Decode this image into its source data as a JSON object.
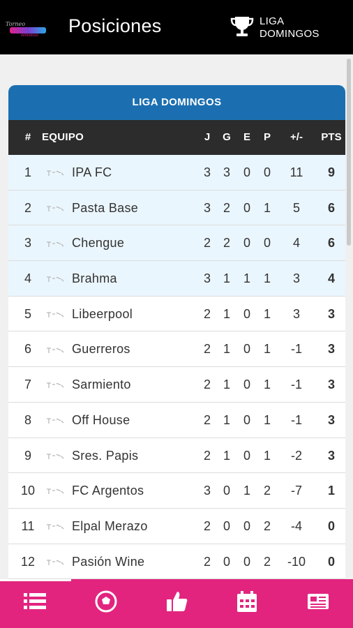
{
  "header": {
    "logo_line1": "Torneo",
    "logo_line3": "Amistoso",
    "title": "Posiciones",
    "league_label_line1": "LIGA",
    "league_label_line2": "DOMINGOS"
  },
  "table": {
    "caption": "LIGA DOMINGOS",
    "columns": {
      "pos": "#",
      "team": "EQUIPO",
      "j": "J",
      "g": "G",
      "e": "E",
      "p": "P",
      "dif": "+/-",
      "pts": "PTS"
    },
    "rows": [
      {
        "pos": "1",
        "team": "IPA FC",
        "j": "3",
        "g": "3",
        "e": "0",
        "p": "0",
        "dif": "11",
        "pts": "9"
      },
      {
        "pos": "2",
        "team": "Pasta Base",
        "j": "3",
        "g": "2",
        "e": "0",
        "p": "1",
        "dif": "5",
        "pts": "6"
      },
      {
        "pos": "3",
        "team": "Chengue",
        "j": "2",
        "g": "2",
        "e": "0",
        "p": "0",
        "dif": "4",
        "pts": "6"
      },
      {
        "pos": "4",
        "team": "Brahma",
        "j": "3",
        "g": "1",
        "e": "1",
        "p": "1",
        "dif": "3",
        "pts": "4"
      },
      {
        "pos": "5",
        "team": "Libeerpool",
        "j": "2",
        "g": "1",
        "e": "0",
        "p": "1",
        "dif": "3",
        "pts": "3"
      },
      {
        "pos": "6",
        "team": "Guerreros",
        "j": "2",
        "g": "1",
        "e": "0",
        "p": "1",
        "dif": "-1",
        "pts": "3"
      },
      {
        "pos": "7",
        "team": "Sarmiento",
        "j": "2",
        "g": "1",
        "e": "0",
        "p": "1",
        "dif": "-1",
        "pts": "3"
      },
      {
        "pos": "8",
        "team": "Off House",
        "j": "2",
        "g": "1",
        "e": "0",
        "p": "1",
        "dif": "-1",
        "pts": "3"
      },
      {
        "pos": "9",
        "team": "Sres. Papis",
        "j": "2",
        "g": "1",
        "e": "0",
        "p": "1",
        "dif": "-2",
        "pts": "3"
      },
      {
        "pos": "10",
        "team": "FC Argentos",
        "j": "3",
        "g": "0",
        "e": "1",
        "p": "2",
        "dif": "-7",
        "pts": "1"
      },
      {
        "pos": "11",
        "team": "Elpal Merazo",
        "j": "2",
        "g": "0",
        "e": "0",
        "p": "2",
        "dif": "-4",
        "pts": "0"
      },
      {
        "pos": "12",
        "team": "Pasión Wine",
        "j": "2",
        "g": "0",
        "e": "0",
        "p": "2",
        "dif": "-10",
        "pts": "0"
      }
    ]
  },
  "nav": {
    "items": [
      {
        "icon": "standings-list-icon",
        "active": true
      },
      {
        "icon": "soccer-ball-icon",
        "active": false
      },
      {
        "icon": "thumbs-up-icon",
        "active": false
      },
      {
        "icon": "calendar-icon",
        "active": false
      },
      {
        "icon": "news-icon",
        "active": false
      }
    ]
  },
  "colors": {
    "header_bg": "#000000",
    "card_header": "#1b6fb0",
    "table_header": "#2c2c2c",
    "top_rows_bg": "#eaf6fd",
    "nav_bg": "#e2247f"
  }
}
